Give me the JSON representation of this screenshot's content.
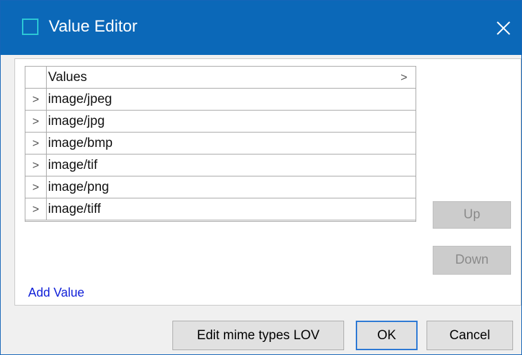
{
  "window": {
    "title": "Value Editor",
    "close_label": "×",
    "title_bar_color": "#0b68b8"
  },
  "grid": {
    "column_header": "Values",
    "header_chevron": ">",
    "row_chevron": ">",
    "rows": [
      {
        "value": "image/jpeg"
      },
      {
        "value": "image/jpg"
      },
      {
        "value": "image/bmp"
      },
      {
        "value": "image/tif"
      },
      {
        "value": "image/png"
      },
      {
        "value": "image/tiff"
      }
    ]
  },
  "add_value_label": "Add Value",
  "side_buttons": {
    "up_label": "Up",
    "down_label": "Down"
  },
  "footer_buttons": {
    "edit_mime_label": "Edit mime types LOV",
    "ok_label": "OK",
    "cancel_label": "Cancel"
  },
  "icons": {
    "app": "window-icon",
    "close": "close-icon",
    "row_expand": "chevron-right-icon"
  }
}
